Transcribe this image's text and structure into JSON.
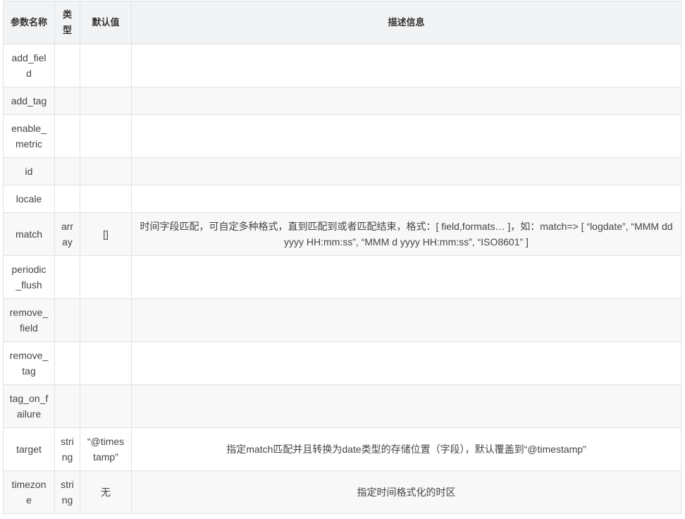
{
  "table": {
    "headers": [
      "参数名称",
      "类型",
      "默认值",
      "描述信息"
    ],
    "rows": [
      {
        "name": "add_field",
        "type": "",
        "default": "",
        "desc": ""
      },
      {
        "name": "add_tag",
        "type": "",
        "default": "",
        "desc": ""
      },
      {
        "name": "enable_metric",
        "type": "",
        "default": "",
        "desc": ""
      },
      {
        "name": "id",
        "type": "",
        "default": "",
        "desc": ""
      },
      {
        "name": "locale",
        "type": "",
        "default": "",
        "desc": ""
      },
      {
        "name": "match",
        "type": "array",
        "default": "[]",
        "desc": "时间字段匹配，可自定多种格式，直到匹配到或者匹配结束，格式：[ field,formats… ]，如：match=> [ “logdate”, “MMM dd yyyy HH:mm:ss”, “MMM d yyyy HH:mm:ss”, “ISO8601” ]"
      },
      {
        "name": "periodic_flush",
        "type": "",
        "default": "",
        "desc": ""
      },
      {
        "name": "remove_field",
        "type": "",
        "default": "",
        "desc": ""
      },
      {
        "name": "remove_tag",
        "type": "",
        "default": "",
        "desc": ""
      },
      {
        "name": "tag_on_failure",
        "type": "",
        "default": "",
        "desc": ""
      },
      {
        "name": "target",
        "type": "string",
        "default": "“@timestamp”",
        "desc": "指定match匹配并且转换为date类型的存储位置（字段），默认覆盖到“@timestamp”"
      },
      {
        "name": "timezone",
        "type": "string",
        "default": "无",
        "desc": "指定时间格式化的时区"
      }
    ]
  }
}
